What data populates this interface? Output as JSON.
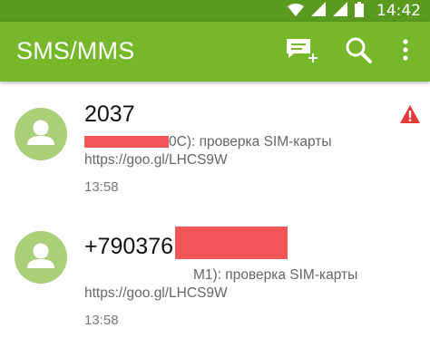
{
  "status_bar": {
    "time": "14:42",
    "icons": [
      "wifi-icon",
      "signal-icon",
      "signal-icon",
      "battery-icon"
    ]
  },
  "app_bar": {
    "title": "SMS/MMS",
    "actions": [
      "new-message-icon",
      "search-icon",
      "overflow-menu-icon"
    ]
  },
  "colors": {
    "app_bar": "#76b82a",
    "status_bar": "#5a9a1f",
    "avatar": "#a9d077",
    "redaction": "#f25555",
    "alert": "#e53935"
  },
  "conversations": [
    {
      "sender": "2037",
      "snippet_visible": "0C): проверка SIM-карты",
      "link": "https://goo.gl/LHCS9W",
      "time": "13:58",
      "has_alert": true
    },
    {
      "sender": "+790376",
      "snippet_visible": "M1): проверка SIM-карты",
      "link": "https://goo.gl/LHCS9W",
      "time": "13:58",
      "has_alert": false
    }
  ]
}
